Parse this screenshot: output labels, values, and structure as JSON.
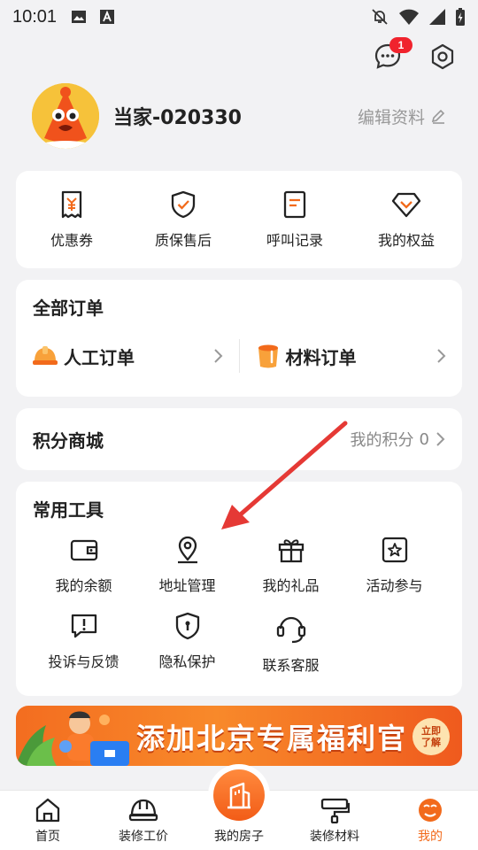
{
  "status_bar": {
    "time": "10:01"
  },
  "header": {
    "message_badge": "1"
  },
  "profile": {
    "username": "当家-020330",
    "edit_label": "编辑资料"
  },
  "quick_actions": [
    {
      "label": "优惠券",
      "icon": "coupon-icon"
    },
    {
      "label": "质保售后",
      "icon": "shield-check-icon"
    },
    {
      "label": "呼叫记录",
      "icon": "call-record-icon"
    },
    {
      "label": "我的权益",
      "icon": "diamond-icon"
    }
  ],
  "orders": {
    "title": "全部订单",
    "items": [
      {
        "label": "人工订单",
        "icon": "helmet-icon"
      },
      {
        "label": "材料订单",
        "icon": "paint-bucket-icon"
      }
    ]
  },
  "points": {
    "title": "积分商城",
    "my_points_label": "我的积分",
    "my_points_value": "0"
  },
  "tools": {
    "title": "常用工具",
    "items": [
      {
        "label": "我的余额",
        "icon": "wallet-icon"
      },
      {
        "label": "地址管理",
        "icon": "location-pin-icon"
      },
      {
        "label": "我的礼品",
        "icon": "gift-icon"
      },
      {
        "label": "活动参与",
        "icon": "star-badge-icon"
      },
      {
        "label": "投诉与反馈",
        "icon": "feedback-icon"
      },
      {
        "label": "隐私保护",
        "icon": "privacy-shield-icon"
      },
      {
        "label": "联系客服",
        "icon": "headset-icon"
      }
    ]
  },
  "banner": {
    "text": "添加北京专属福利官",
    "cta": "立即了解"
  },
  "tabbar": [
    {
      "label": "首页",
      "icon": "home-icon"
    },
    {
      "label": "装修工价",
      "icon": "helmet-icon"
    },
    {
      "label": "我的房子",
      "icon": "building-icon"
    },
    {
      "label": "装修材料",
      "icon": "roller-icon"
    },
    {
      "label": "我的",
      "icon": "profile-icon",
      "active": true
    }
  ],
  "colors": {
    "accent": "#f26a1b",
    "badge": "#f0232d",
    "annotation_arrow": "#e53935"
  }
}
